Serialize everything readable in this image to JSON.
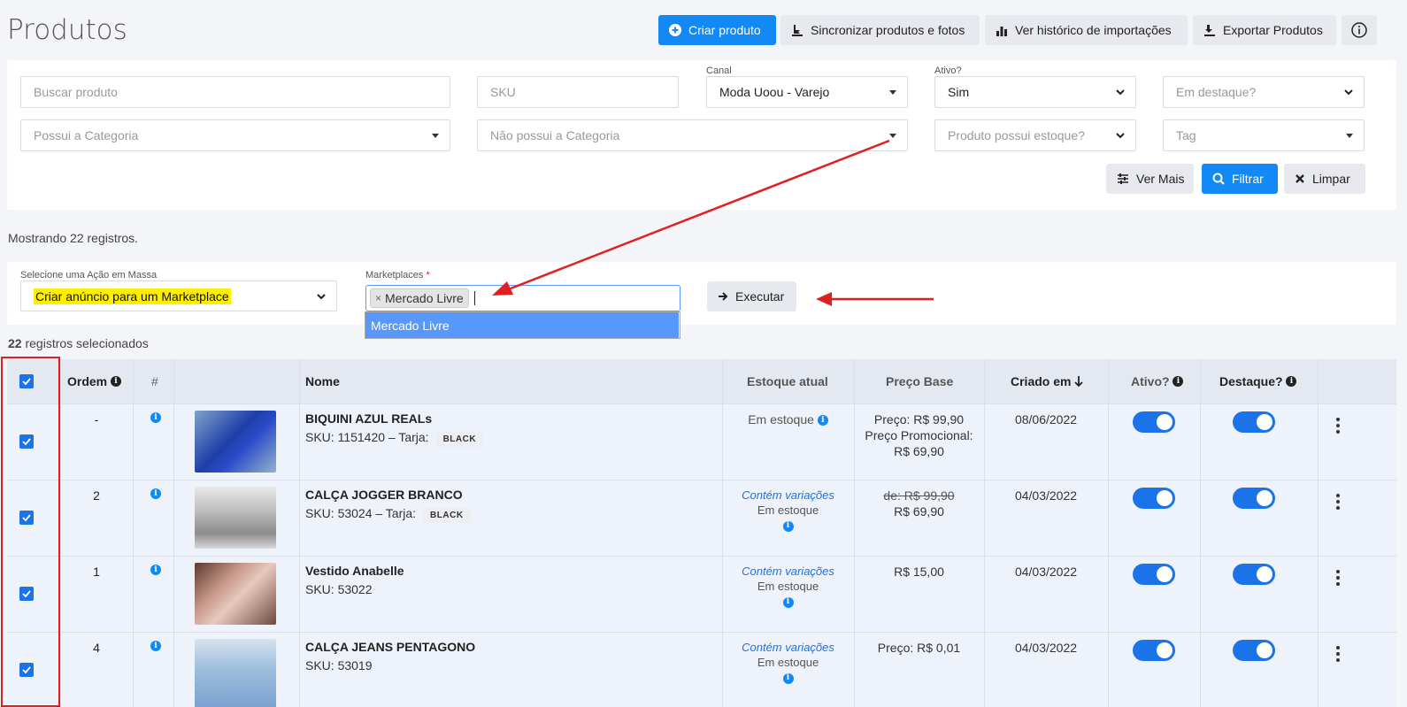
{
  "page_title": "Produtos",
  "toolbar": {
    "create": "Criar produto",
    "sync": "Sincronizar produtos e fotos",
    "history": "Ver histórico de importações",
    "export": "Exportar Produtos"
  },
  "filters": {
    "search_placeholder": "Buscar produto",
    "sku_placeholder": "SKU",
    "canal_label": "Canal",
    "canal_value": "Moda Uoou - Varejo",
    "ativo_label": "Ativo?",
    "ativo_value": "Sim",
    "destaque_placeholder": "Em destaque?",
    "possui_categoria": "Possui a Categoria",
    "nao_possui_categoria": "Não possui a Categoria",
    "estoque_placeholder": "Produto possui estoque?",
    "tag_placeholder": "Tag",
    "ver_mais": "Ver Mais",
    "filtrar": "Filtrar",
    "limpar": "Limpar"
  },
  "records_text": "Mostrando 22 registros.",
  "mass_action": {
    "label": "Selecione uma Ação em Massa",
    "value": "Criar anúncio para um Marketplace",
    "marketplaces_label": "Marketplaces",
    "required_mark": "*",
    "chip": "Mercado Livre",
    "chip_remove": "×",
    "dropdown_option": "Mercado Livre",
    "execute": "Executar"
  },
  "selected": {
    "count": "22",
    "text": " registros selecionados"
  },
  "table": {
    "headers": {
      "ordem": "Ordem",
      "hash": "#",
      "nome": "Nome",
      "estoque": "Estoque atual",
      "preco": "Preço Base",
      "criado": "Criado em",
      "ativo": "Ativo?",
      "destaque": "Destaque?"
    },
    "rows": [
      {
        "ordem": "-",
        "name": "BIQUINI AZUL REALs",
        "sku": "SKU: 1151420 – Tarja:",
        "badge": "BLACK",
        "stock_variation": "",
        "stock": "Em estoque",
        "price_line1": "Preço: R$ 99,90",
        "price_line2": "Preço Promocional:",
        "price_line3": "R$ 69,90",
        "created": "08/06/2022",
        "ativo": true,
        "destaque": true
      },
      {
        "ordem": "2",
        "name": "CALÇA JOGGER BRANCO",
        "sku": "SKU: 53024 – Tarja:",
        "badge": "BLACK",
        "stock_variation": "Contém variações",
        "stock": "Em estoque",
        "price_line1": "de: R$ 99,90",
        "price_line2": "R$ 69,90",
        "price_line3": "",
        "created": "04/03/2022",
        "ativo": true,
        "destaque": true
      },
      {
        "ordem": "1",
        "name": "Vestido Anabelle",
        "sku": "SKU: 53022",
        "badge": "",
        "stock_variation": "Contém variações",
        "stock": "Em estoque",
        "price_line1": "R$ 15,00",
        "price_line2": "",
        "price_line3": "",
        "created": "04/03/2022",
        "ativo": true,
        "destaque": true
      },
      {
        "ordem": "4",
        "name": "CALÇA JEANS PENTAGONO",
        "sku": "SKU: 53019",
        "badge": "",
        "stock_variation": "Contém variações",
        "stock": "Em estoque",
        "price_line1": "Preço: R$ 0,01",
        "price_line2": "",
        "price_line3": "",
        "created": "04/03/2022",
        "ativo": true,
        "destaque": true
      }
    ]
  },
  "colors": {
    "primary": "#1389f6",
    "highlight": "#ffee00",
    "annotation_red": "#e02020",
    "toggle_on": "#1a73e8"
  }
}
